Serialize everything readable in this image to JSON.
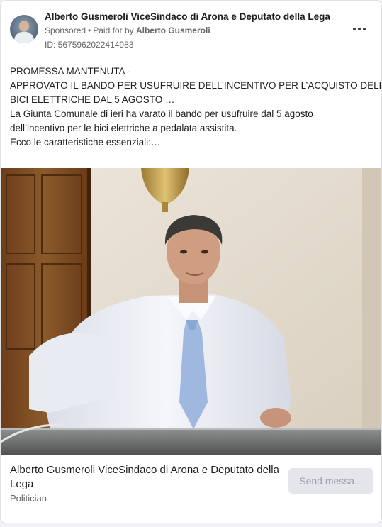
{
  "header": {
    "page_name": "Alberto Gusmeroli ViceSindaco di Arona e Deputato della Lega",
    "sponsored": "Sponsored",
    "separator": "•",
    "paid_for_prefix": "Paid for by",
    "paid_for_name": "Alberto Gusmeroli",
    "ad_id": "ID: 5675962022414983"
  },
  "post": {
    "lines": [
      "PROMESSA MANTENUTA -",
      "APPROVATO IL BANDO PER USUFRUIRE DELL’INCENTIVO PER L’ACQUISTO DELLE",
      "BICI ELETTRICHE DAL 5 AGOSTO …",
      "La Giunta Comunale di ieri ha varato il bando per usufruire dal 5 agosto",
      "dell’incentivo per le bici elettriche a pedalata assistita.",
      "Ecco le caratteristiche essenziali:…"
    ]
  },
  "footer": {
    "title": "Alberto Gusmeroli ViceSindaco di Arona e Deputato della Lega",
    "subtitle": "Politician",
    "send_button": "Send messa..."
  },
  "icons": {
    "more": "more-dots-icon"
  },
  "colors": {
    "text_primary": "#1c1e21",
    "text_secondary": "#65676b",
    "button_bg": "#e4e6eb"
  }
}
